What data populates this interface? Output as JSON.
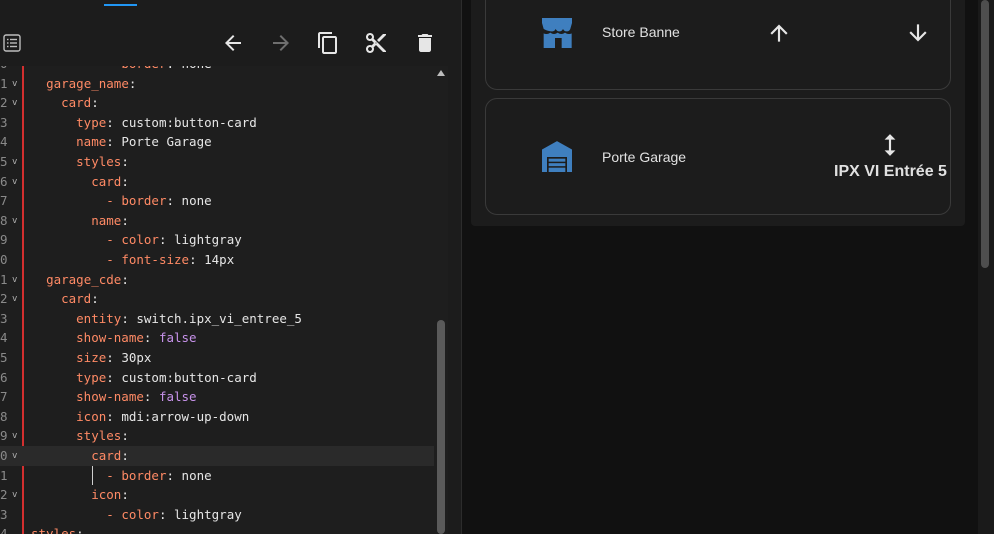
{
  "colors": {
    "accent": "#2196f3",
    "gutter_marker": "#d32f2f",
    "yaml_key": "#ff8a65",
    "yaml_bool": "#c792ea",
    "icon_blue": "#3f7fbf"
  },
  "toolbar": {
    "list_icon": "list-icon",
    "undo_icon": "arrow-left-icon",
    "redo_icon": "arrow-right-icon",
    "copy_icon": "copy-icon",
    "cut_icon": "scissors-icon",
    "delete_icon": "trash-icon"
  },
  "code_lines": [
    {
      "ln": "0",
      "fold": "",
      "indent": "          ",
      "key": "- border",
      "val": " none",
      "type": "str"
    },
    {
      "ln": "1",
      "fold": "v",
      "indent": "  ",
      "key": "garage_name",
      "val": "",
      "type": "str"
    },
    {
      "ln": "2",
      "fold": "v",
      "indent": "    ",
      "key": "card",
      "val": "",
      "type": "str"
    },
    {
      "ln": "3",
      "fold": "",
      "indent": "      ",
      "key": "type",
      "val": " custom:button-card",
      "type": "str"
    },
    {
      "ln": "4",
      "fold": "",
      "indent": "      ",
      "key": "name",
      "val": " Porte Garage",
      "type": "str"
    },
    {
      "ln": "5",
      "fold": "v",
      "indent": "      ",
      "key": "styles",
      "val": "",
      "type": "str"
    },
    {
      "ln": "6",
      "fold": "v",
      "indent": "        ",
      "key": "card",
      "val": "",
      "type": "str"
    },
    {
      "ln": "7",
      "fold": "",
      "indent": "          ",
      "key": "- border",
      "val": " none",
      "type": "str"
    },
    {
      "ln": "8",
      "fold": "v",
      "indent": "        ",
      "key": "name",
      "val": "",
      "type": "str"
    },
    {
      "ln": "9",
      "fold": "",
      "indent": "          ",
      "key": "- color",
      "val": " lightgray",
      "type": "str"
    },
    {
      "ln": "0",
      "fold": "",
      "indent": "          ",
      "key": "- font-size",
      "val": " 14px",
      "type": "str"
    },
    {
      "ln": "1",
      "fold": "v",
      "indent": "  ",
      "key": "garage_cde",
      "val": "",
      "type": "str"
    },
    {
      "ln": "2",
      "fold": "v",
      "indent": "    ",
      "key": "card",
      "val": "",
      "type": "str"
    },
    {
      "ln": "3",
      "fold": "",
      "indent": "      ",
      "key": "entity",
      "val": " switch.ipx_vi_entree_5",
      "type": "str"
    },
    {
      "ln": "4",
      "fold": "",
      "indent": "      ",
      "key": "show-name",
      "val": " false",
      "type": "bool"
    },
    {
      "ln": "5",
      "fold": "",
      "indent": "      ",
      "key": "size",
      "val": " 30px",
      "type": "str"
    },
    {
      "ln": "6",
      "fold": "",
      "indent": "      ",
      "key": "type",
      "val": " custom:button-card",
      "type": "str"
    },
    {
      "ln": "7",
      "fold": "",
      "indent": "      ",
      "key": "show-name",
      "val": " false",
      "type": "bool"
    },
    {
      "ln": "8",
      "fold": "",
      "indent": "      ",
      "key": "icon",
      "val": " mdi:arrow-up-down",
      "type": "str"
    },
    {
      "ln": "9",
      "fold": "v",
      "indent": "      ",
      "key": "styles",
      "val": "",
      "type": "str"
    },
    {
      "ln": "0",
      "fold": "v",
      "indent": "        ",
      "key": "card",
      "val": "",
      "type": "str",
      "active": true
    },
    {
      "ln": "1",
      "fold": "",
      "indent": "          ",
      "key": "- border",
      "val": " none",
      "type": "str"
    },
    {
      "ln": "2",
      "fold": "v",
      "indent": "        ",
      "key": "icon",
      "val": "",
      "type": "str"
    },
    {
      "ln": "3",
      "fold": "",
      "indent": "          ",
      "key": "- color",
      "val": " lightgray",
      "type": "str"
    },
    {
      "ln": "4",
      "fold": "",
      "indent": "",
      "key": "styles",
      "val": "",
      "type": "str"
    }
  ],
  "preview": {
    "card1": {
      "icon": "storefront-icon",
      "name": "Store Banne",
      "up_icon": "arrow-up-icon",
      "down_icon": "arrow-down-icon"
    },
    "card2": {
      "icon": "garage-icon",
      "name": "Porte Garage",
      "toggle_icon": "arrow-up-down-icon",
      "entity_label": "IPX VI Entrée 5"
    }
  }
}
